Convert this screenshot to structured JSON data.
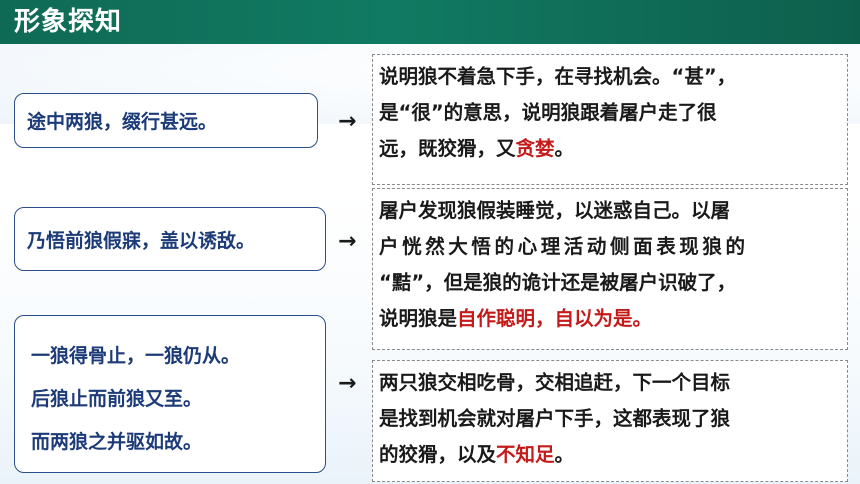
{
  "header": {
    "title": "形象探知"
  },
  "left_boxes": {
    "b1": "途中两狼，缀行甚远。",
    "b2": "乃悟前狼假寐，盖以诱敌。",
    "b3": [
      "一狼得骨止，一狼仍从。",
      "后狼止而前狼又至。",
      "而两狼之并驱如故。"
    ]
  },
  "arrow": "→",
  "right_boxes": {
    "r1": {
      "l1": "说明狼不着急下手，在寻找机会。“甚”，",
      "l2": "是“很”的意思，说明狼跟着屠户走了很",
      "l3": "远，既狡猾，又",
      "l3_red": "贪婪",
      "l3_end": "。"
    },
    "r2": {
      "l1": "屠户发现狼假装睡觉，以迷惑自己。以屠",
      "l2": "户恍然大悟的心理活动侧面表现狼的",
      "l3": "“黠”，但是狼的诡计还是被屠户识破了，",
      "l4": "说明狼是",
      "l4_red": "自作聪明，自以为是。"
    },
    "r3": {
      "l1": "两只狼交相吃骨，交相追赶，下一个目标",
      "l2": "是找到机会就对屠户下手，这都表现了狼",
      "l3": "的狡猾，以及",
      "l3_red": "不知足",
      "l3_end": "。"
    }
  },
  "colors": {
    "header": "#117a62",
    "accent_red": "#c41a1a",
    "box_text": "#1c3b78"
  }
}
